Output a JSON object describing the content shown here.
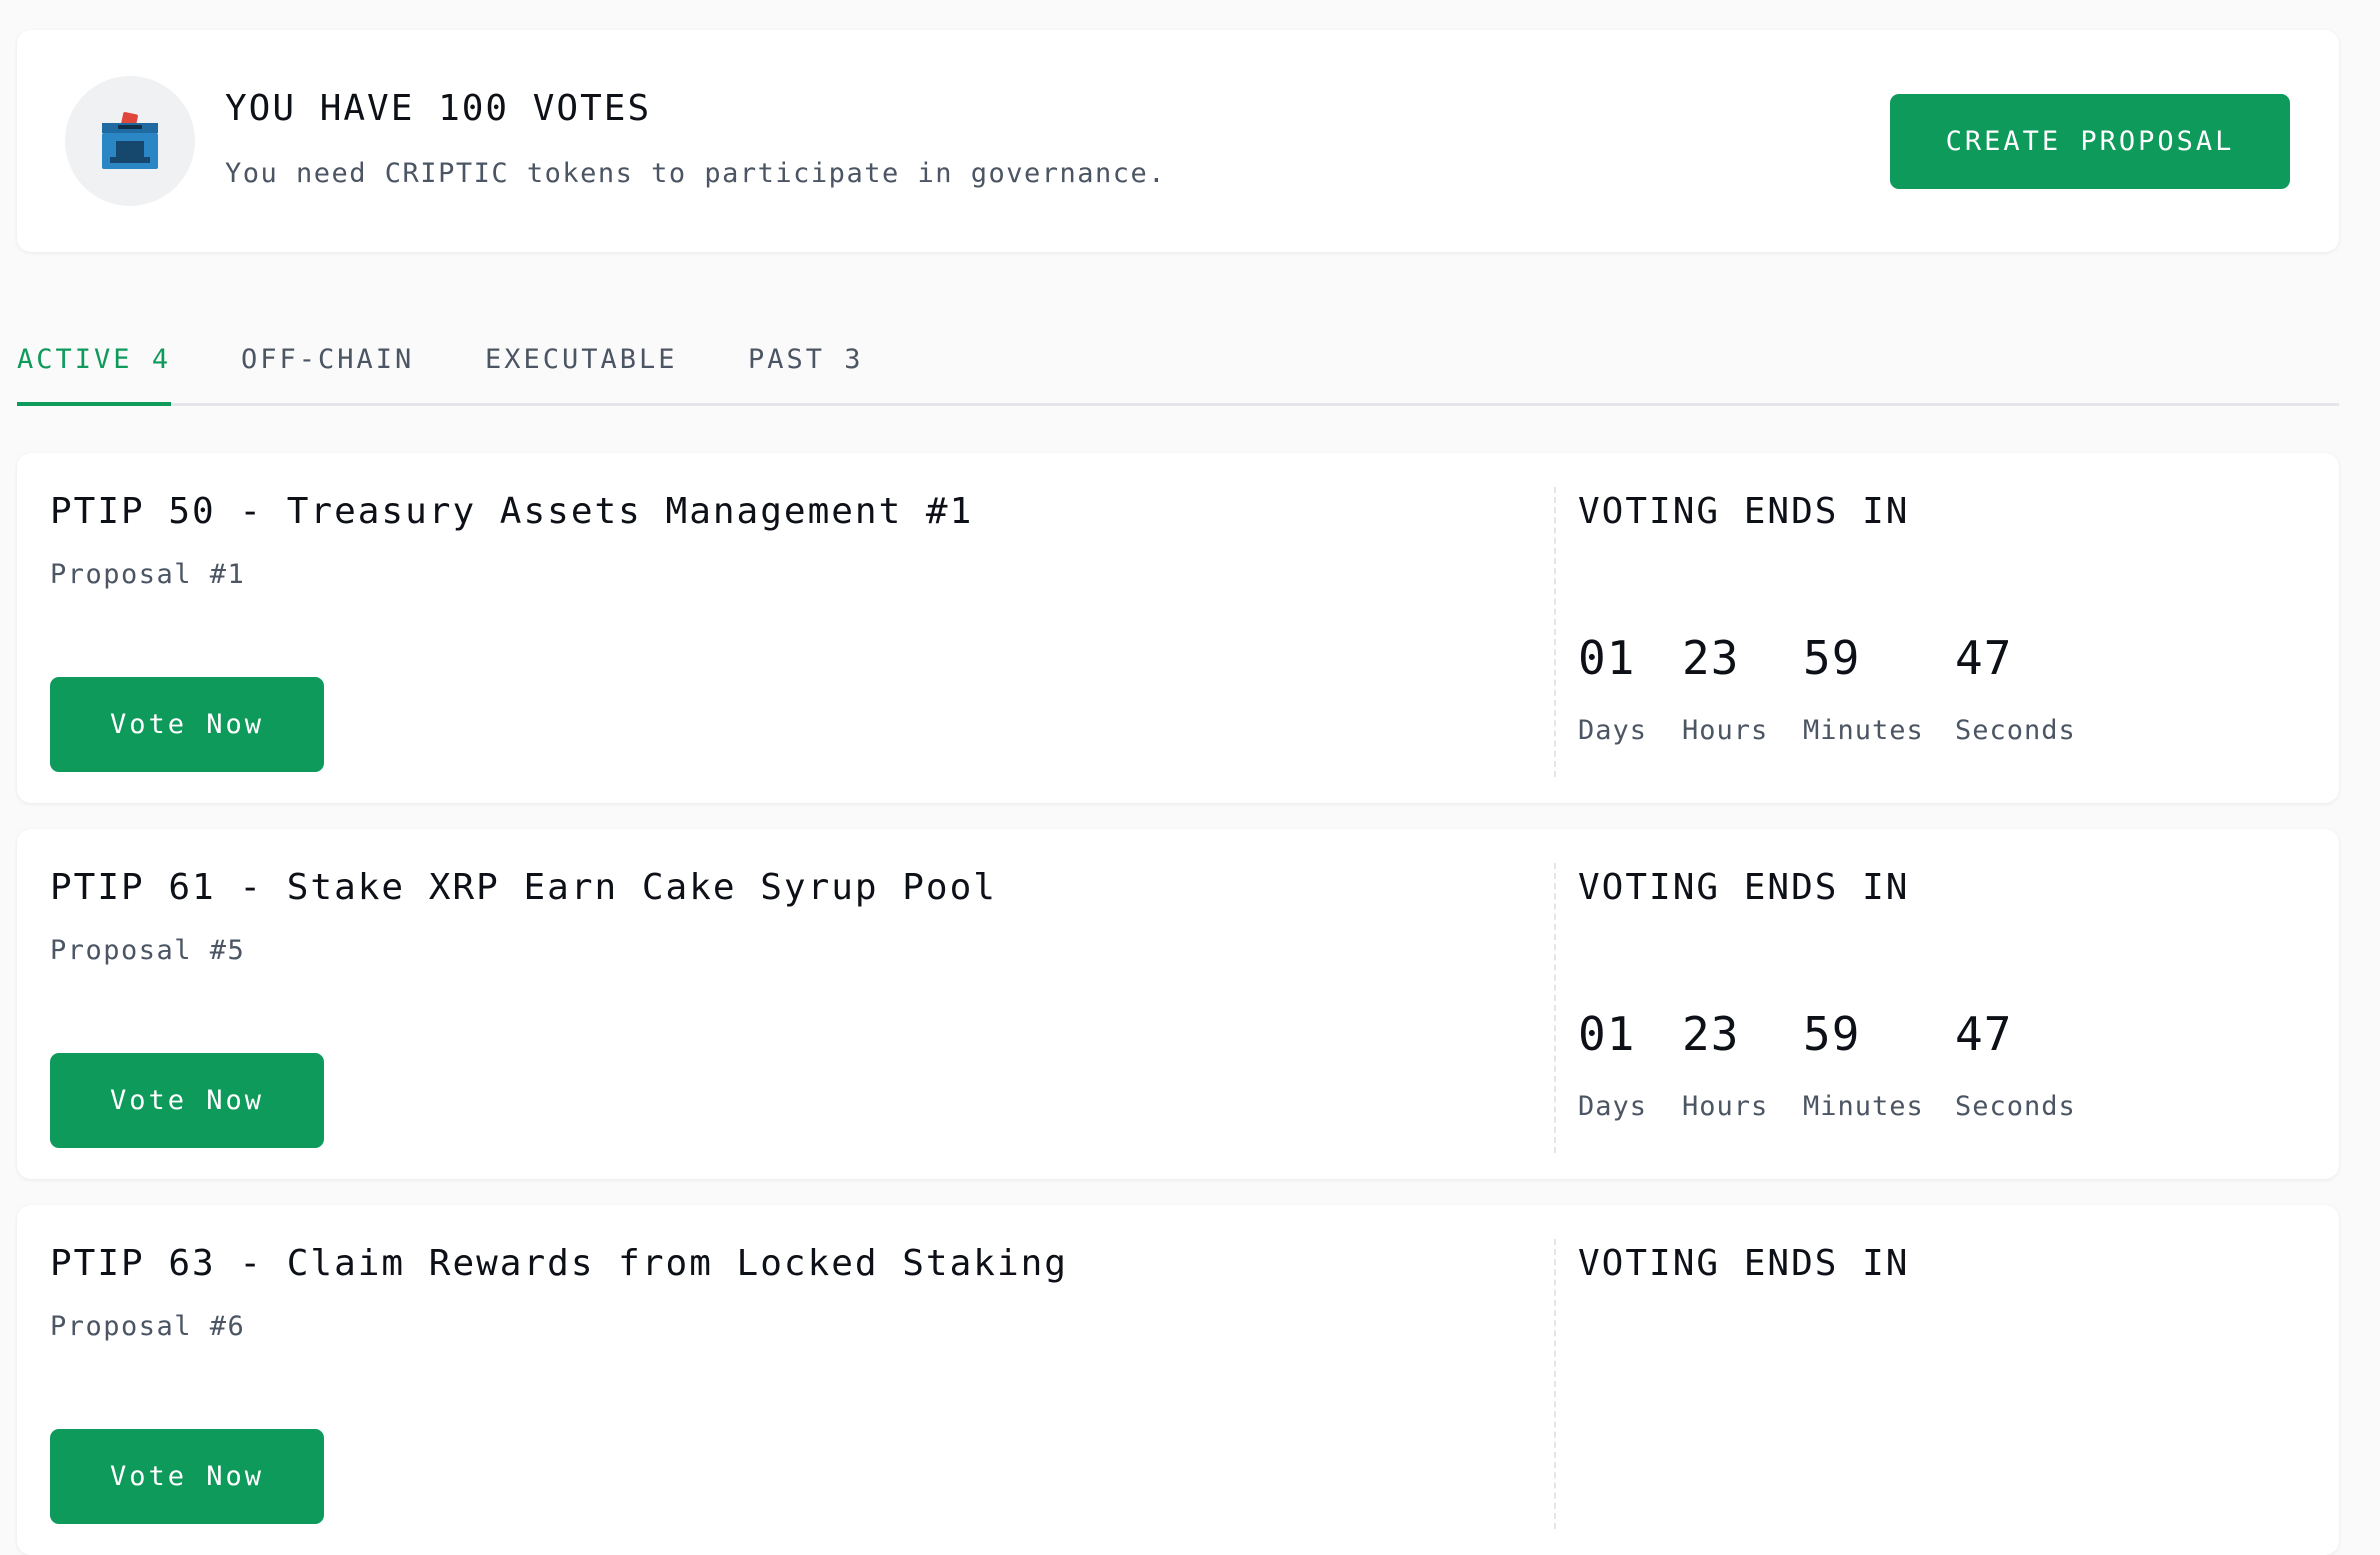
{
  "votes_card": {
    "title": "YOU HAVE 100 VOTES",
    "subtitle": "You need CRIPTIC tokens to participate in governance.",
    "create_button": "CREATE PROPOSAL",
    "icon": "ballot-box-icon"
  },
  "tabs": [
    {
      "label": "ACTIVE",
      "count": "4",
      "active": true
    },
    {
      "label": "OFF-CHAIN",
      "count": ""
    },
    {
      "label": "EXECUTABLE",
      "count": ""
    },
    {
      "label": "PAST",
      "count": "3"
    }
  ],
  "proposals": [
    {
      "title": "PTIP 50 - Treasury Assets Management #1",
      "number": "Proposal #1",
      "button": "Vote Now",
      "ends_label": "VOTING ENDS IN",
      "countdown": {
        "days": "01",
        "hours": "23",
        "minutes": "59",
        "seconds": "47"
      }
    },
    {
      "title": "PTIP 61 - Stake XRP Earn Cake Syrup Pool",
      "number": "Proposal #5",
      "button": "Vote Now",
      "ends_label": "VOTING ENDS IN",
      "countdown": {
        "days": "01",
        "hours": "23",
        "minutes": "59",
        "seconds": "47"
      }
    },
    {
      "title": "PTIP 63 - Claim Rewards from Locked Staking",
      "number": "Proposal #6",
      "button": "Vote Now",
      "ends_label": "VOTING ENDS IN",
      "countdown": {
        "days": "",
        "hours": "",
        "minutes": "",
        "seconds": ""
      }
    }
  ],
  "countdown_labels": {
    "days": "Days",
    "hours": "Hours",
    "minutes": "Minutes",
    "seconds": "Seconds"
  },
  "colors": {
    "accent": "#0d9a5a",
    "text": "#0d1117",
    "muted": "#4b5563",
    "background": "#fafafa"
  }
}
